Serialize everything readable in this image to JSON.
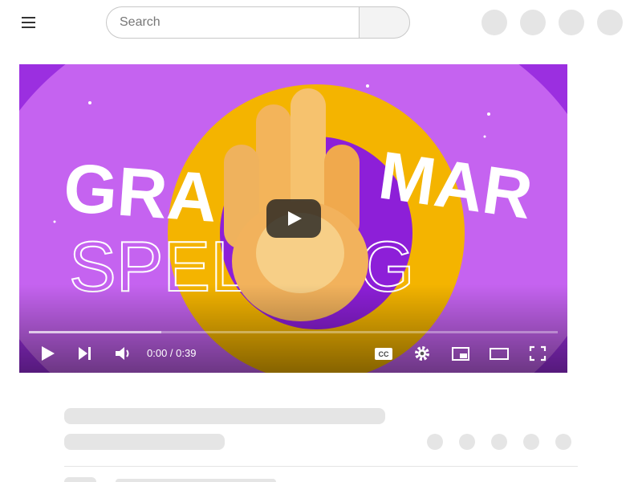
{
  "search": {
    "placeholder": "Search"
  },
  "video": {
    "time_display": "0:00 / 0:39",
    "progress_fraction": 0.25,
    "thumbnail_text": {
      "line1": "GRA",
      "line2": "MAR",
      "line3": "SPELLING"
    }
  },
  "icons": {
    "menu": "hamburger-menu-icon",
    "search": "search-icon",
    "play": "play-icon",
    "next": "next-icon",
    "volume": "volume-icon",
    "captions": "cc-icon",
    "settings": "gear-icon",
    "miniplayer": "miniplayer-icon",
    "theater": "theater-mode-icon",
    "fullscreen": "fullscreen-icon"
  },
  "colors": {
    "thumbnail_bg": "#c563f0",
    "ring": "#f4b400",
    "skeleton": "#e5e5e5"
  }
}
